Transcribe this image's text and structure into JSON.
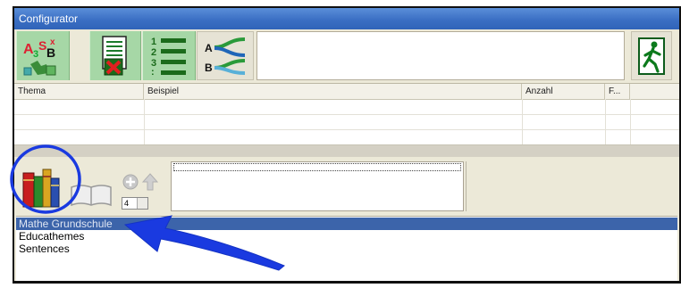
{
  "window": {
    "title": "Configurator"
  },
  "toolbar": {
    "buttons": [
      {
        "icon": "spelling-game-icon"
      },
      {
        "icon": "delete-document-icon"
      },
      {
        "icon": "numbered-list-icon"
      },
      {
        "icon": "matching-ab-icon"
      },
      {
        "icon": "exit-door-icon"
      }
    ],
    "text_value": ""
  },
  "grid": {
    "columns": [
      "Thema",
      "Beispiel",
      "Anzahl",
      "F..."
    ],
    "rows": []
  },
  "midbar": {
    "spinner_value": "4",
    "text_value": ""
  },
  "list": {
    "items": [
      "Mathe Grundschule",
      "Educathemes",
      "Sentences"
    ],
    "selected_index": 0
  },
  "colors": {
    "accent": "#3c64aa",
    "annotation": "#1a3ae0",
    "toolbar_button": "#a6d7a6"
  }
}
